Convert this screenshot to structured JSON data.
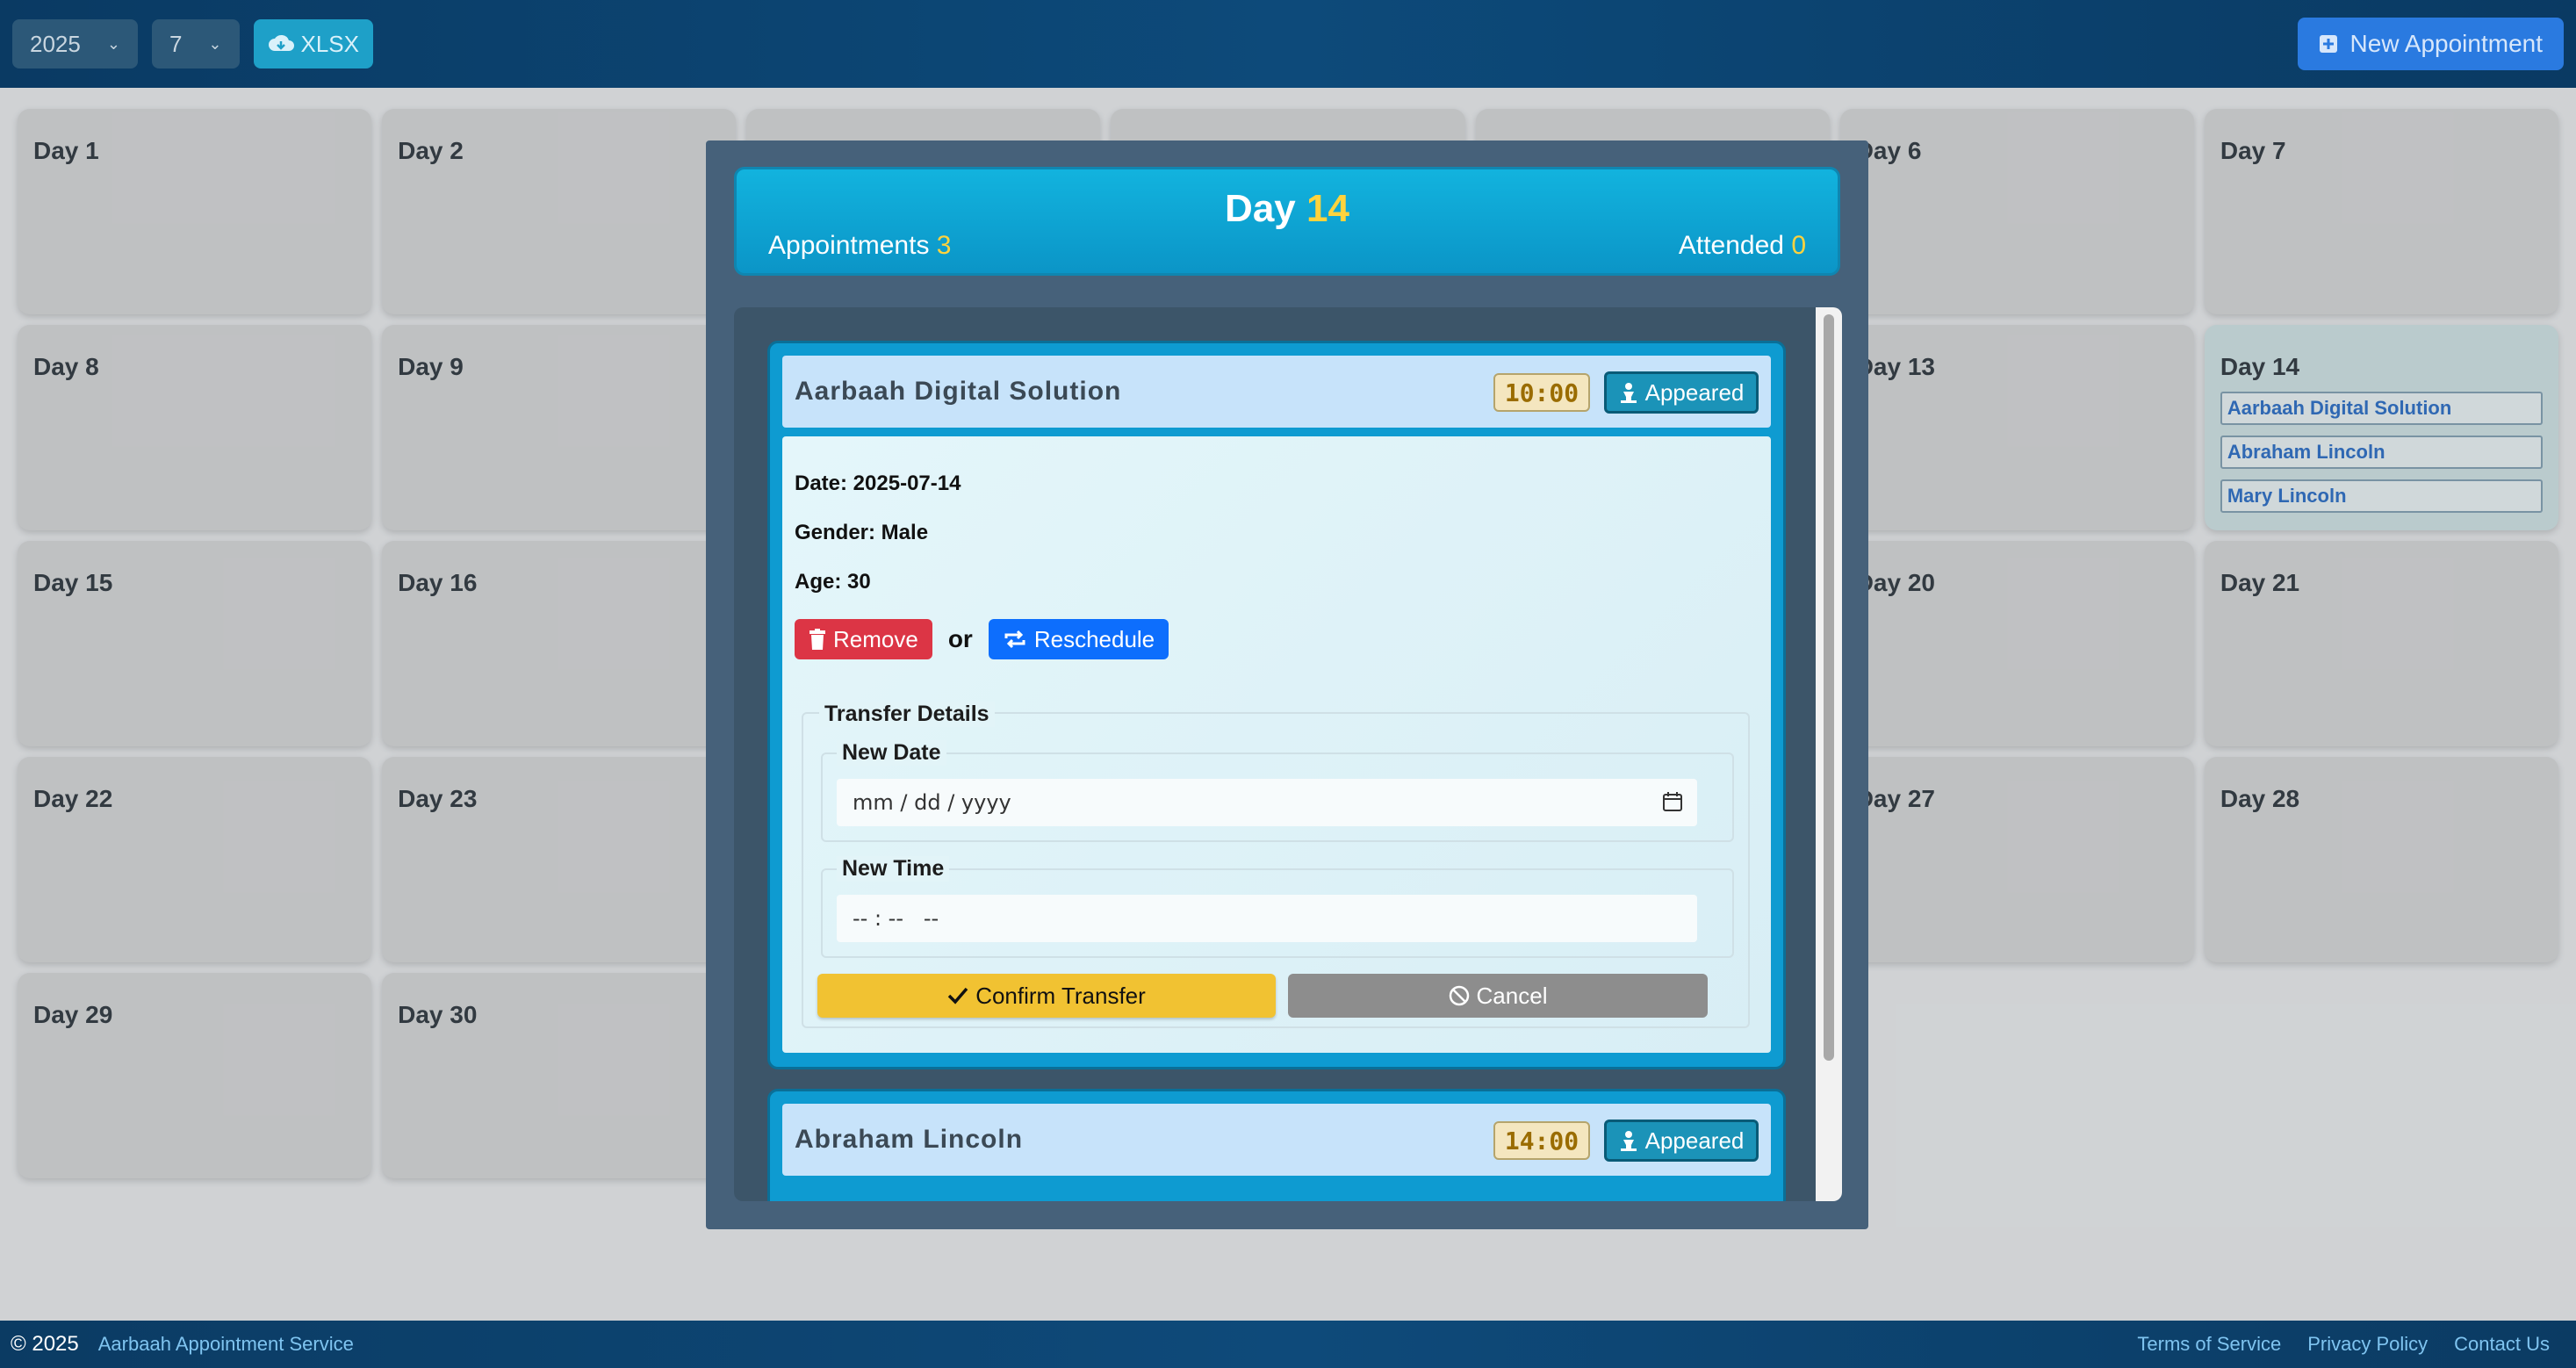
{
  "toolbar": {
    "year": "2025",
    "month": "7",
    "export_label": "XLSX",
    "new_appointment_label": "New Appointment"
  },
  "calendar": {
    "days": [
      {
        "label": "Day 1"
      },
      {
        "label": "Day 2"
      },
      {
        "label": ""
      },
      {
        "label": ""
      },
      {
        "label": ""
      },
      {
        "label": "Day 6"
      },
      {
        "label": "Day 7"
      },
      {
        "label": "Day 8"
      },
      {
        "label": "Day 9"
      },
      {
        "label": ""
      },
      {
        "label": ""
      },
      {
        "label": ""
      },
      {
        "label": "Day 13"
      },
      {
        "label": "Day 14"
      },
      {
        "label": "Day 15"
      },
      {
        "label": "Day 16"
      },
      {
        "label": ""
      },
      {
        "label": ""
      },
      {
        "label": ""
      },
      {
        "label": "Day 20"
      },
      {
        "label": "Day 21"
      },
      {
        "label": "Day 22"
      },
      {
        "label": "Day 23"
      },
      {
        "label": ""
      },
      {
        "label": ""
      },
      {
        "label": ""
      },
      {
        "label": "Day 27"
      },
      {
        "label": "Day 28"
      },
      {
        "label": "Day 29"
      },
      {
        "label": "Day 30"
      }
    ],
    "day14_appointments": [
      "Aarbaah Digital Solution",
      "Abraham Lincoln",
      "Mary Lincoln"
    ]
  },
  "modal": {
    "title_prefix": "Day",
    "title_day": "14",
    "appointments_label": "Appointments",
    "appointments_count": "3",
    "attended_label": "Attended",
    "attended_count": "0",
    "cards": [
      {
        "name": "Aarbaah Digital Solution",
        "time": "10:00",
        "status": "Appeared",
        "date": "Date: 2025-07-14",
        "gender": "Gender: Male",
        "age": "Age: 30",
        "remove_label": "Remove",
        "or_label": "or",
        "reschedule_label": "Reschedule",
        "transfer_legend": "Transfer Details",
        "new_date_legend": "New Date",
        "new_date_placeholder": "mm / dd / yyyy",
        "new_time_legend": "New Time",
        "new_time_placeholder": "-- : --   --",
        "confirm_label": "Confirm Transfer",
        "cancel_label": "Cancel"
      },
      {
        "name": "Abraham Lincoln",
        "time": "14:00",
        "status": "Appeared"
      }
    ]
  },
  "footer": {
    "copyright": "© 2025",
    "brand": "Aarbaah Appointment Service",
    "links": [
      "Terms of Service",
      "Privacy Policy",
      "Contact Us"
    ]
  },
  "colors": {
    "header_bg": "#0d4a7a",
    "accent_yellow": "#ffd33d",
    "remove_red": "#dc3545",
    "reschedule_blue": "#0d6efd",
    "confirm_yellow": "#f1c232",
    "cancel_gray": "#8d8d8d"
  }
}
